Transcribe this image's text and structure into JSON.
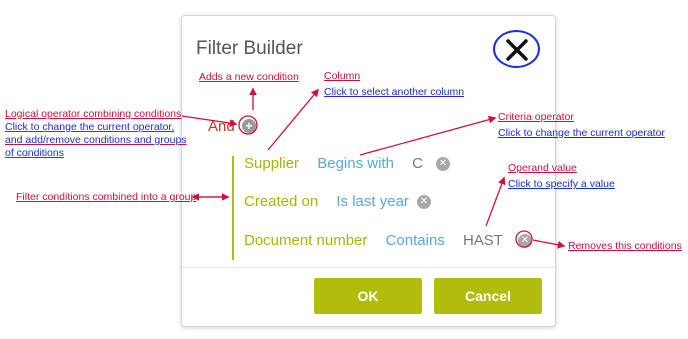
{
  "dialog": {
    "title": "Filter Builder",
    "ok_label": "OK",
    "cancel_label": "Cancel"
  },
  "filter": {
    "group_operator": "And",
    "conditions": [
      {
        "field": "Supplier",
        "operator": "Begins with",
        "value": "C"
      },
      {
        "field": "Created on",
        "operator": "Is last year",
        "value": ""
      },
      {
        "field": "Document number",
        "operator": "Contains",
        "value": "HAST"
      }
    ]
  },
  "annotations": {
    "add_condition": "Adds a new condition",
    "column_title": "Column",
    "column_hint": "Click to select another column",
    "logical_op": [
      "Logical operator combining conditions",
      "Click to change the current operator,",
      "and add/remove conditions and groups",
      "of conditions"
    ],
    "criteria_title": "Criteria operator",
    "criteria_hint": "Click to change the current operator",
    "group": "Filter conditions combined into a group",
    "operand_title": "Operand value",
    "operand_hint": "Click to specify a value",
    "removes": "Removes this conditions"
  },
  "colors": {
    "accent": "#b2bc0c",
    "field": "#a8b40a",
    "operator": "#5aa7e0",
    "annotation": "#d0103a",
    "annotation_link": "#1c2cd6"
  }
}
